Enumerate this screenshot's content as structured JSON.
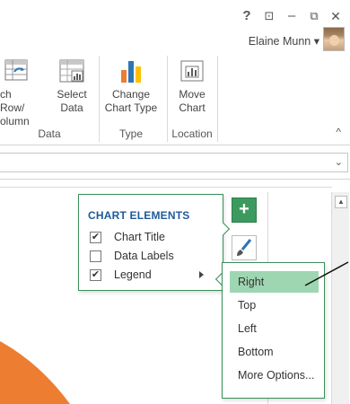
{
  "window": {
    "help_label": "?",
    "restore_ribbon_label": "⊡",
    "minimize_label": "–",
    "maximize_label": "⧉",
    "close_label": "✕",
    "user_name": "Elaine Munn ▾"
  },
  "ribbon": {
    "switch_row_column": [
      "ch Row/",
      "olumn"
    ],
    "select_data": [
      "Select",
      "Data"
    ],
    "change_chart_type": [
      "Change",
      "Chart Type"
    ],
    "move_chart": [
      "Move",
      "Chart"
    ],
    "groups": {
      "data": "Data",
      "type": "Type",
      "location": "Location"
    },
    "collapse_label": "^"
  },
  "formula_bar": {
    "dropdown_label": "⌄"
  },
  "chart_elements": {
    "title": "CHART ELEMENTS",
    "items": [
      {
        "label": "Chart Title",
        "checked": true
      },
      {
        "label": "Data Labels",
        "checked": false
      },
      {
        "label": "Legend",
        "checked": true
      }
    ],
    "plus_label": "+"
  },
  "legend_menu": {
    "items": [
      "Right",
      "Top",
      "Left",
      "Bottom",
      "More Options..."
    ],
    "selected": "Right"
  },
  "colors": {
    "accent_green": "#3c9a5f",
    "highlight_green": "#9fd6b2",
    "title_blue": "#1f5a99",
    "pie_orange": "#ed7d31"
  }
}
